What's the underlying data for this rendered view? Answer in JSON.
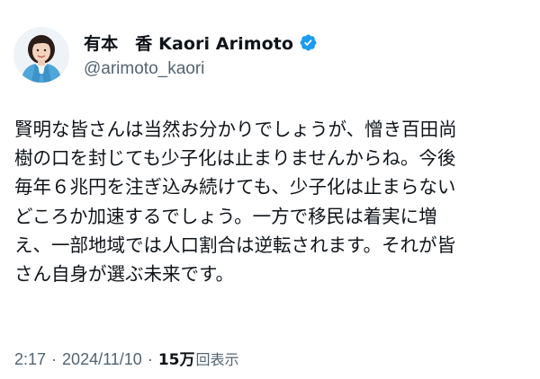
{
  "author": {
    "display_name": "有本　香  Kaori Arimoto",
    "handle": "@arimoto_kaori",
    "verified_icon": "verified-badge-icon",
    "verified_color": "#1d9bf0"
  },
  "post": {
    "lines": [
      "賢明な皆さんは当然お分かりでしょうが、憎き百田尚",
      "樹の口を封じても少子化は止まりませんからね。今後",
      "毎年６兆円を注ぎ込み続けても、少子化は止まらない",
      "どころか加速するでしょう。一方で移民は着実に増",
      "え、一部地域では人口割合は逆転されます。それが皆",
      "さん自身が選ぶ未来です。"
    ]
  },
  "meta": {
    "time": "2:17",
    "separator": "·",
    "date": "2024/11/10",
    "views_count": "15万",
    "views_label": "回表示"
  }
}
